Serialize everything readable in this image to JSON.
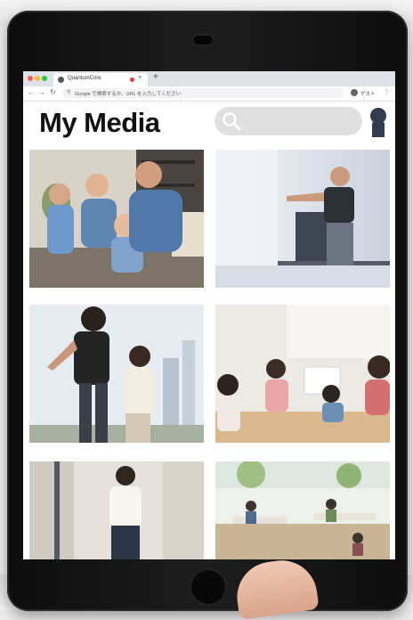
{
  "browser": {
    "tab_title": "QuantumCore",
    "new_tab_glyph": "+",
    "close_glyph": "×",
    "address_placeholder": "Google で検索するか、URL を入力してください",
    "profile_label": "ゲスト",
    "menu_glyph": "⋮"
  },
  "app": {
    "title": "My Media",
    "search": {
      "placeholder": ""
    }
  },
  "media": {
    "tiles": [
      {
        "icon": "family-photo"
      },
      {
        "icon": "gym-treadmill-photo"
      },
      {
        "icon": "couple-running-photo"
      },
      {
        "icon": "classroom-children-photo"
      },
      {
        "icon": "office-woman-photo"
      },
      {
        "icon": "office-workspace-photo"
      }
    ]
  },
  "colors": {
    "tablet_frame": "#111111",
    "screen_bg": "#ffffff",
    "search_bg": "#e0e0e0",
    "avatar": "#2f3d4e",
    "title_text": "#111111"
  }
}
